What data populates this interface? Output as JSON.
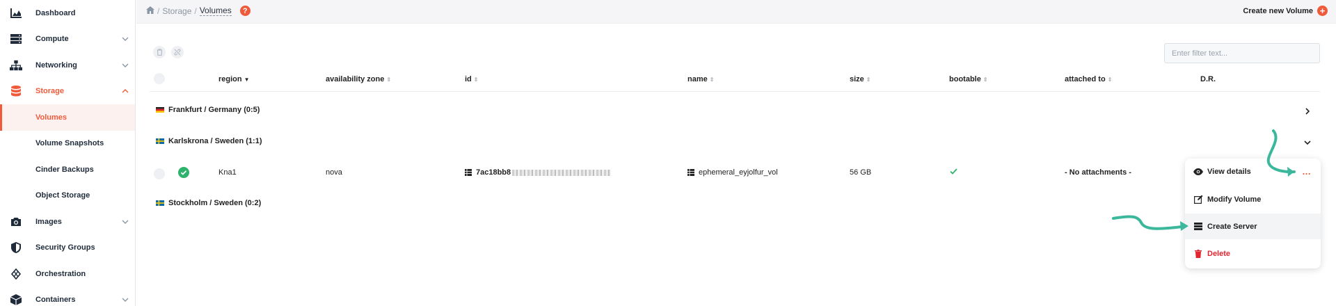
{
  "sidebar": {
    "items": [
      {
        "label": "Dashboard",
        "icon": "chart-icon",
        "has_chevron": false
      },
      {
        "label": "Compute",
        "icon": "server-icon",
        "has_chevron": true
      },
      {
        "label": "Networking",
        "icon": "network-icon",
        "has_chevron": true
      },
      {
        "label": "Storage",
        "icon": "database-icon",
        "has_chevron": true,
        "active": true
      },
      {
        "label": "Images",
        "icon": "camera-icon",
        "has_chevron": true
      },
      {
        "label": "Security Groups",
        "icon": "shield-icon",
        "has_chevron": false
      },
      {
        "label": "Orchestration",
        "icon": "orchestration-icon",
        "has_chevron": false
      },
      {
        "label": "Containers",
        "icon": "box-icon",
        "has_chevron": true
      }
    ],
    "storage_sub": [
      {
        "label": "Volumes",
        "active": true
      },
      {
        "label": "Volume Snapshots"
      },
      {
        "label": "Cinder Backups"
      },
      {
        "label": "Object Storage"
      }
    ]
  },
  "topbar": {
    "breadcrumb": [
      "Storage",
      "Volumes"
    ],
    "help": "?",
    "create_label": "Create new Volume"
  },
  "filter": {
    "placeholder": "Enter filter text..."
  },
  "table": {
    "columns": [
      "region",
      "availability zone",
      "id",
      "name",
      "size",
      "bootable",
      "attached to",
      "D.R."
    ],
    "groups": [
      {
        "label": "Frankfurt / Germany (0:5)",
        "flag": "germany",
        "expanded": false
      },
      {
        "label": "Karlskrona / Sweden (1:1)",
        "flag": "sweden",
        "expanded": true
      },
      {
        "label": "Stockholm / Sweden (0:2)",
        "flag": "sweden",
        "expanded": false
      }
    ],
    "row": {
      "region": "Kna1",
      "availability_zone": "nova",
      "id": "7ac18bb8",
      "name": "ephemeral_eyjolfur_vol",
      "size": "56 GB",
      "bootable": true,
      "attached_to": "- No attachments -"
    }
  },
  "menu": {
    "items": [
      {
        "label": "View details",
        "icon": "eye-icon"
      },
      {
        "label": "Modify Volume",
        "icon": "edit-icon"
      },
      {
        "label": "Create Server",
        "icon": "server-icon"
      },
      {
        "label": "Delete",
        "icon": "trash-icon"
      }
    ],
    "more": "..."
  },
  "colors": {
    "accent": "#ef5a3b",
    "success": "#2db36b",
    "danger": "#e0262f",
    "arrow": "#3bb89c"
  }
}
